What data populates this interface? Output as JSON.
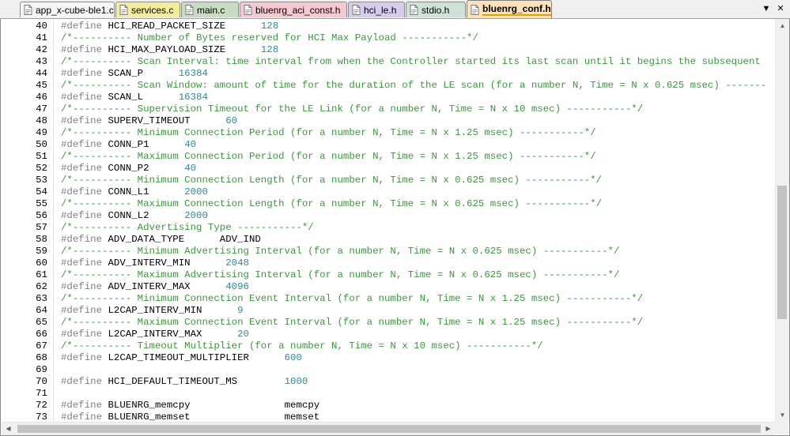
{
  "tabs": [
    {
      "label": "app_x-cube-ble1.c",
      "color": "#f5f5f5",
      "icon": "c-file-icon"
    },
    {
      "label": "services.c",
      "color": "#f3ec9b",
      "icon": "c-file-icon"
    },
    {
      "label": "main.c",
      "color": "#c7dcc0",
      "icon": "c-file-icon"
    },
    {
      "label": "bluenrg_aci_const.h",
      "color": "#f7c8d2",
      "icon": "h-file-icon"
    },
    {
      "label": "hci_le.h",
      "color": "#d7cdea",
      "icon": "h-file-icon"
    },
    {
      "label": "stdio.h",
      "color": "#cfe2d6",
      "icon": "h-file-icon"
    },
    {
      "label": "bluenrg_conf.h",
      "color": "#fde2b8",
      "icon": "h-file-icon",
      "active": true
    }
  ],
  "tab_controls": {
    "dropdown": "▼",
    "close": "✕"
  },
  "editor": {
    "lines": [
      {
        "n": "40",
        "kw": "#define ",
        "name": "HCI_READ_PACKET_SIZE",
        "pad": "      ",
        "value": "128",
        "vtype": "num"
      },
      {
        "n": "41",
        "comment": "/*---------- Number of Bytes reserved for HCI Max Payload -----------*/"
      },
      {
        "n": "42",
        "kw": "#define ",
        "name": "HCI_MAX_PAYLOAD_SIZE",
        "pad": "      ",
        "value": "128",
        "vtype": "num"
      },
      {
        "n": "43",
        "comment": "/*---------- Scan Interval: time interval from when the Controller started its last scan until it begins the subsequent"
      },
      {
        "n": "44",
        "kw": "#define ",
        "name": "SCAN_P",
        "pad": "      ",
        "value": "16384",
        "vtype": "num"
      },
      {
        "n": "45",
        "comment": "/*---------- Scan Window: amount of time for the duration of the LE scan (for a number N, Time = N x 0.625 msec) -------"
      },
      {
        "n": "46",
        "kw": "#define ",
        "name": "SCAN_L",
        "pad": "      ",
        "value": "16384",
        "vtype": "num"
      },
      {
        "n": "47",
        "comment": "/*---------- Supervision Timeout for the LE Link (for a number N, Time = N x 10 msec) -----------*/"
      },
      {
        "n": "48",
        "kw": "#define ",
        "name": "SUPERV_TIMEOUT",
        "pad": "      ",
        "value": "60",
        "vtype": "num"
      },
      {
        "n": "49",
        "comment": "/*---------- Minimum Connection Period (for a number N, Time = N x 1.25 msec) -----------*/"
      },
      {
        "n": "50",
        "kw": "#define ",
        "name": "CONN_P1",
        "pad": "      ",
        "value": "40",
        "vtype": "num"
      },
      {
        "n": "51",
        "comment": "/*---------- Maximum Connection Period (for a number N, Time = N x 1.25 msec) -----------*/"
      },
      {
        "n": "52",
        "kw": "#define ",
        "name": "CONN_P2",
        "pad": "      ",
        "value": "40",
        "vtype": "num"
      },
      {
        "n": "53",
        "comment": "/*---------- Minimum Connection Length (for a number N, Time = N x 0.625 msec) -----------*/"
      },
      {
        "n": "54",
        "kw": "#define ",
        "name": "CONN_L1",
        "pad": "      ",
        "value": "2000",
        "vtype": "num"
      },
      {
        "n": "55",
        "comment": "/*---------- Maximum Connection Length (for a number N, Time = N x 0.625 msec) -----------*/"
      },
      {
        "n": "56",
        "kw": "#define ",
        "name": "CONN_L2",
        "pad": "      ",
        "value": "2000",
        "vtype": "num"
      },
      {
        "n": "57",
        "comment": "/*---------- Advertising Type -----------*/"
      },
      {
        "n": "58",
        "kw": "#define ",
        "name": "ADV_DATA_TYPE",
        "pad": "      ",
        "value": "ADV_IND",
        "vtype": "val"
      },
      {
        "n": "59",
        "comment": "/*---------- Minimum Advertising Interval (for a number N, Time = N x 0.625 msec) -----------*/"
      },
      {
        "n": "60",
        "kw": "#define ",
        "name": "ADV_INTERV_MIN",
        "pad": "      ",
        "value": "2048",
        "vtype": "num"
      },
      {
        "n": "61",
        "comment": "/*---------- Maximum Advertising Interval (for a number N, Time = N x 0.625 msec) -----------*/"
      },
      {
        "n": "62",
        "kw": "#define ",
        "name": "ADV_INTERV_MAX",
        "pad": "      ",
        "value": "4096",
        "vtype": "num"
      },
      {
        "n": "63",
        "comment": "/*---------- Minimum Connection Event Interval (for a number N, Time = N x 1.25 msec) -----------*/"
      },
      {
        "n": "64",
        "kw": "#define ",
        "name": "L2CAP_INTERV_MIN",
        "pad": "      ",
        "value": "9",
        "vtype": "num"
      },
      {
        "n": "65",
        "comment": "/*---------- Maximum Connection Event Interval (for a number N, Time = N x 1.25 msec) -----------*/"
      },
      {
        "n": "66",
        "kw": "#define ",
        "name": "L2CAP_INTERV_MAX",
        "pad": "      ",
        "value": "20",
        "vtype": "num"
      },
      {
        "n": "67",
        "comment": "/*---------- Timeout Multiplier (for a number N, Time = N x 10 msec) -----------*/"
      },
      {
        "n": "68",
        "kw": "#define ",
        "name": "L2CAP_TIMEOUT_MULTIPLIER",
        "pad": "      ",
        "value": "600",
        "vtype": "num"
      },
      {
        "n": "69"
      },
      {
        "n": "70",
        "kw": "#define ",
        "name": "HCI_DEFAULT_TIMEOUT_MS",
        "pad": "        ",
        "value": "1000",
        "vtype": "num"
      },
      {
        "n": "71"
      },
      {
        "n": "72",
        "kw": "#define ",
        "name": "BLUENRG_memcpy",
        "pad": "                ",
        "value": "memcpy",
        "vtype": "val"
      },
      {
        "n": "73",
        "kw": "#define ",
        "name": "BLUENRG_memset",
        "pad": "                ",
        "value": "memset",
        "vtype": "val"
      }
    ]
  },
  "scrollbars": {
    "up": "▲",
    "down": "▼",
    "left": "◀",
    "right": "▶"
  }
}
